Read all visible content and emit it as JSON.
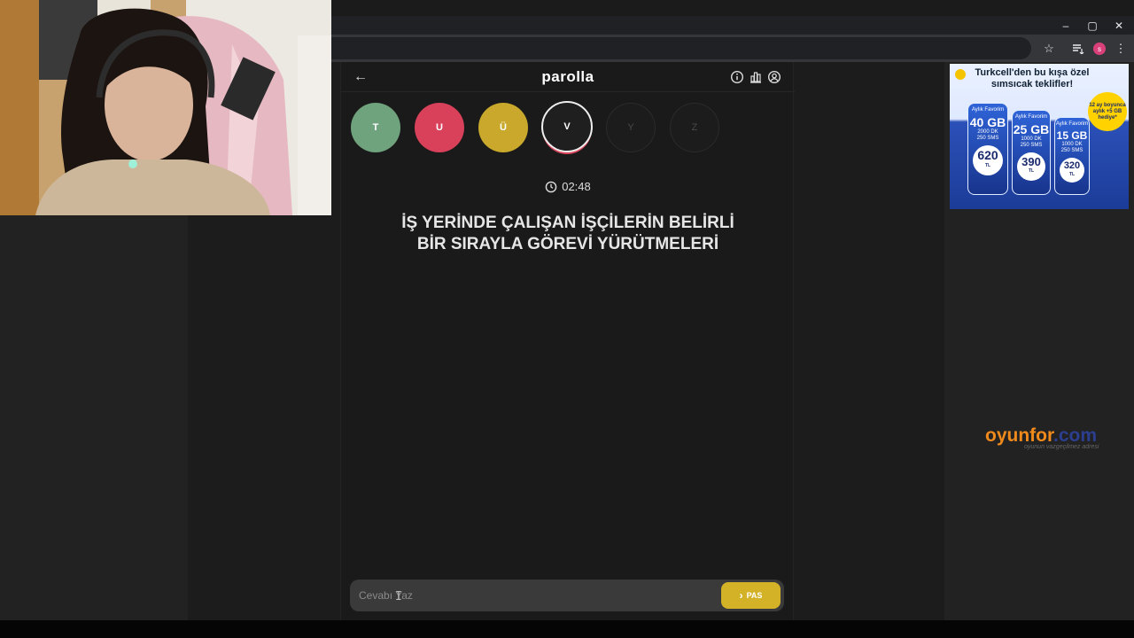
{
  "browser": {
    "window_controls": {
      "minimize": "–",
      "maximize": "▢",
      "close": "✕"
    },
    "profile_initial": "s",
    "colors": {
      "frame": "#202124",
      "toolbar": "#35363a"
    }
  },
  "game": {
    "title": "parolla",
    "letters": [
      {
        "label": "T",
        "state": "correct"
      },
      {
        "label": "U",
        "state": "wrong"
      },
      {
        "label": "Ü",
        "state": "passed"
      },
      {
        "label": "V",
        "state": "current"
      },
      {
        "label": "Y",
        "state": "pending"
      },
      {
        "label": "Z",
        "state": "pending"
      }
    ],
    "timer": "02:48",
    "question": "İŞ YERİNDE ÇALIŞAN İŞÇİLERİN BELİRLİ BİR SIRAYLA GÖREVİ YÜRÜTMELERİ",
    "answer_placeholder": "Cevabı Yaz",
    "pass_label": "PAS",
    "colors": {
      "correct": "#6fa37d",
      "wrong": "#d9415a",
      "passed": "#c9a82b",
      "accent": "#d4b228"
    }
  },
  "ad": {
    "headline": "Turkcell'den bu kışa özel sımsıcak teklifler!",
    "badge": "12 ay boyunca aylık +5 GB hediye*",
    "packages": [
      {
        "name": "Aylık Favorim",
        "gb": "40 GB",
        "minutes": "2000 DK",
        "sms": "250 SMS",
        "price": "620",
        "currency": "TL"
      },
      {
        "name": "Aylık Favorim",
        "gb": "25 GB",
        "minutes": "1000 DK",
        "sms": "250 SMS",
        "price": "390",
        "currency": "TL"
      },
      {
        "name": "Aylık Favorim",
        "gb": "15 GB",
        "minutes": "1000 DK",
        "sms": "250 SMS",
        "price": "320",
        "currency": "TL"
      }
    ]
  },
  "brand": {
    "name_part1": "oyunfor",
    "name_part2": ".com",
    "tagline": "oyunun vazgeçilmez adresi",
    "colors": {
      "part1": "#f08a1c",
      "part2": "#2c3e8f"
    }
  }
}
